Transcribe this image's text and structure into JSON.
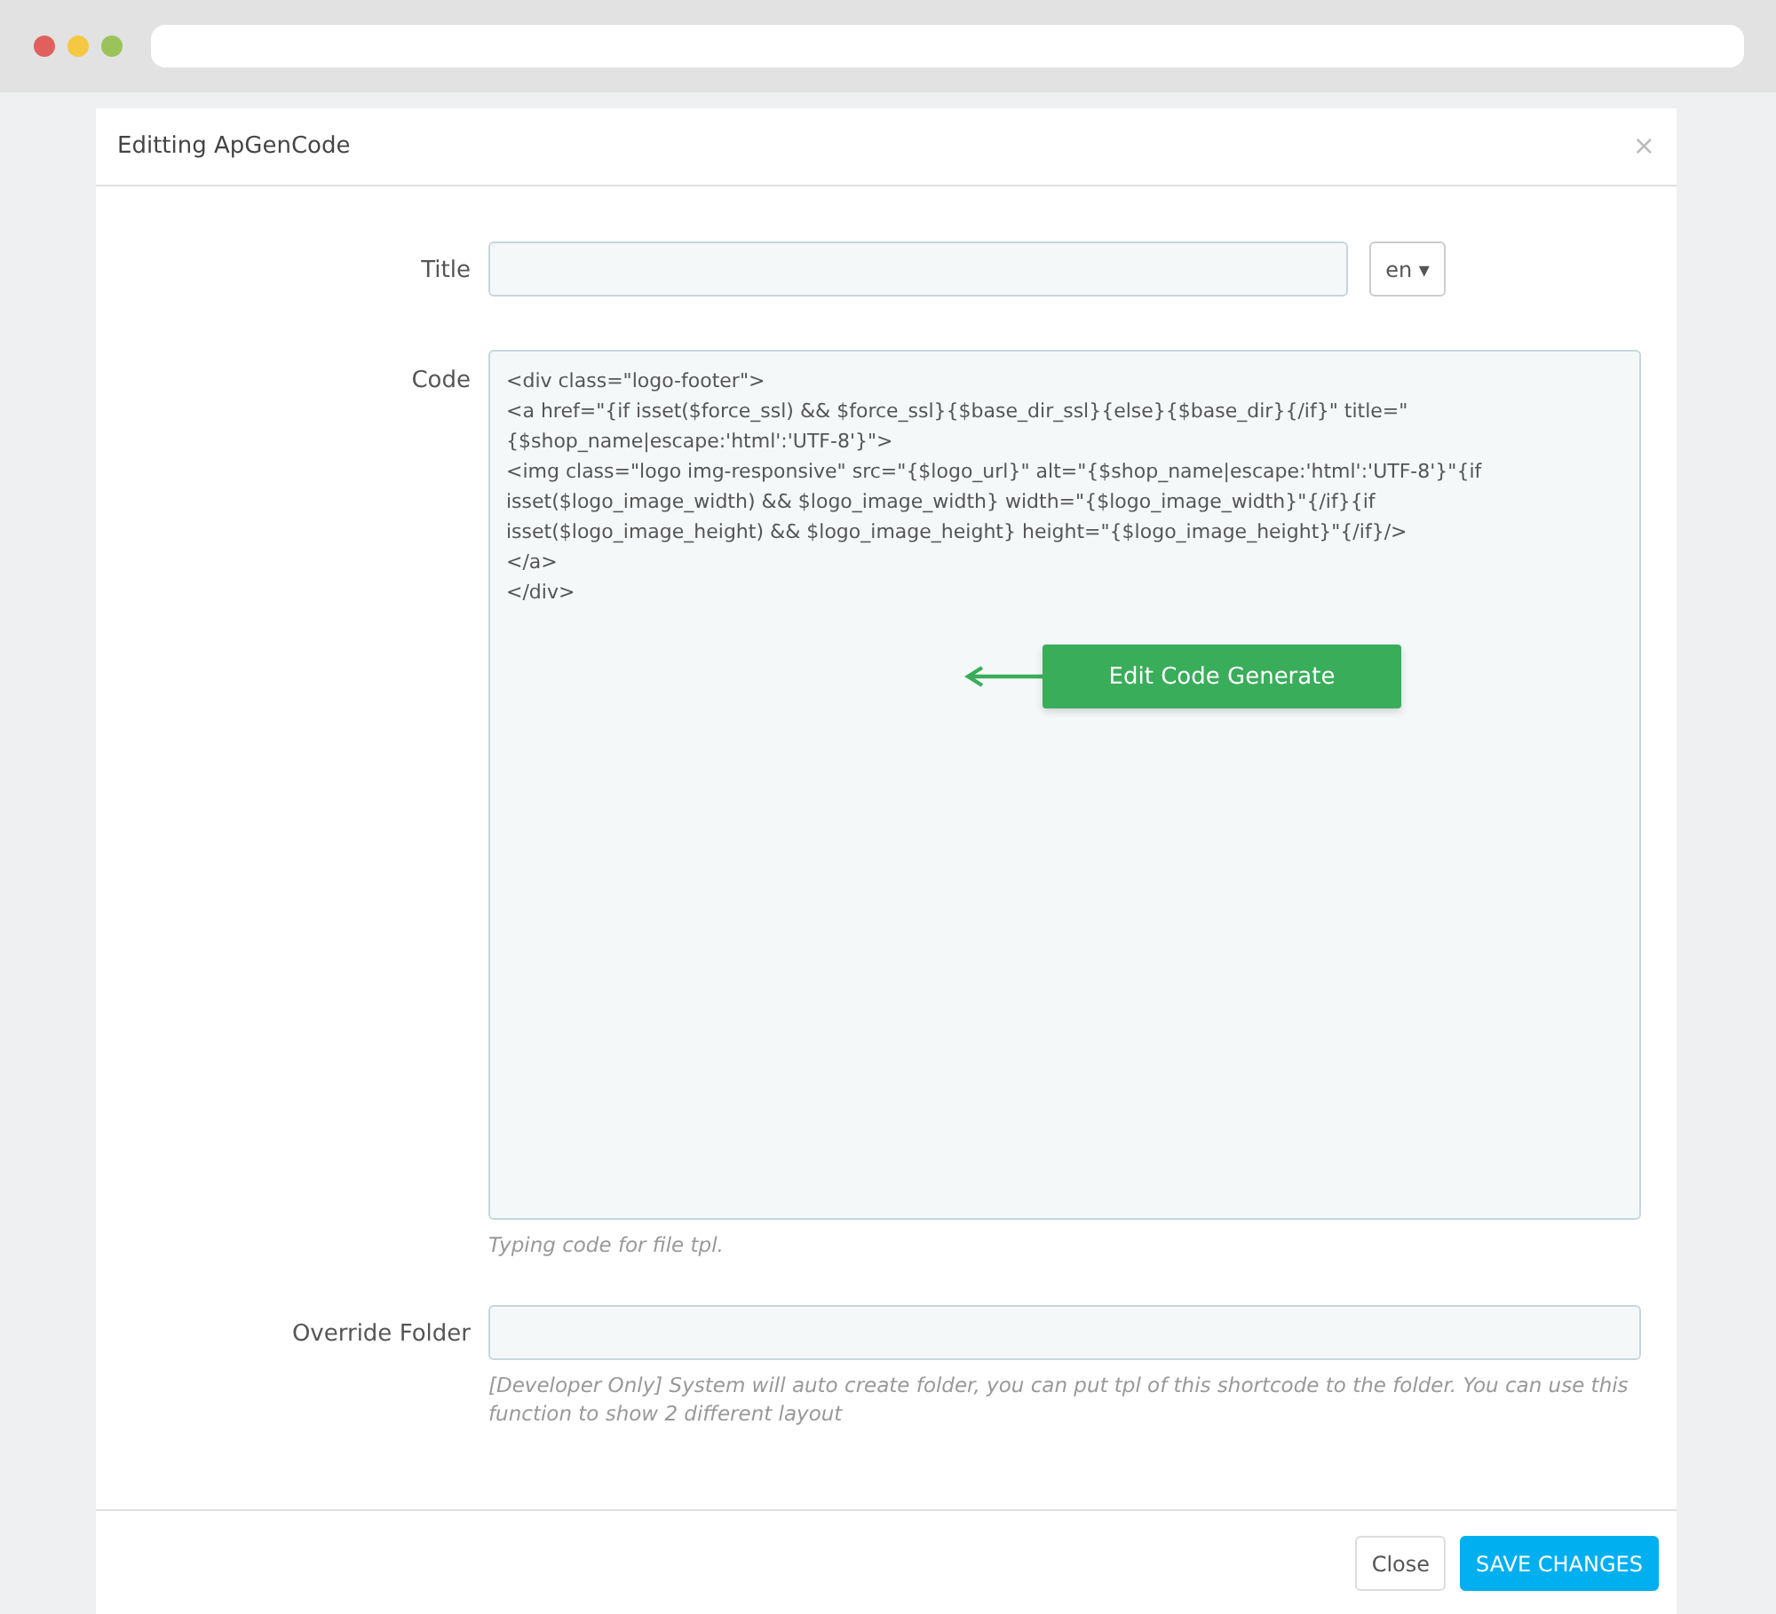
{
  "modal": {
    "title": "Editting ApGenCode",
    "close": "×"
  },
  "fields": [
    {
      "kind": "input",
      "label": "Title",
      "language": "en",
      "caret": "▾"
    },
    {
      "kind": "code",
      "label": "Code",
      "lines": [
        "<div class=\"logo-footer\">",
        "<a href=\"{if isset($force_ssl) && $force_ssl}{$base_dir_ssl}{else}{$base_dir}{/if}\" title=\"{$shop_name|escape:'html':'UTF-8'}\">",
        "<img class=\"logo img-responsive\" src=\"{$logo_url}\" alt=\"{$shop_name|escape:'html':'UTF-8'}\"{if isset($logo_image_width) && $logo_image_width} width=\"{$logo_image_width}\"{/if}{if isset($logo_image_height) && $logo_image_height} height=\"{$logo_image_height}\"{/if}/>",
        "</a>",
        "</div>"
      ],
      "help": "Typing code for file tpl.",
      "annotation": "Edit Code Generate"
    },
    {
      "kind": "input",
      "label": "Override Folder",
      "help": "[Developer Only] System will auto create folder, you can put tpl of this shortcode to the folder. You can use this function to show 2 different layout"
    }
  ],
  "footer": {
    "buttons": [
      {
        "label": "Close",
        "kind": "default"
      },
      {
        "label": "SAVE CHANGES",
        "kind": "primary"
      }
    ]
  }
}
